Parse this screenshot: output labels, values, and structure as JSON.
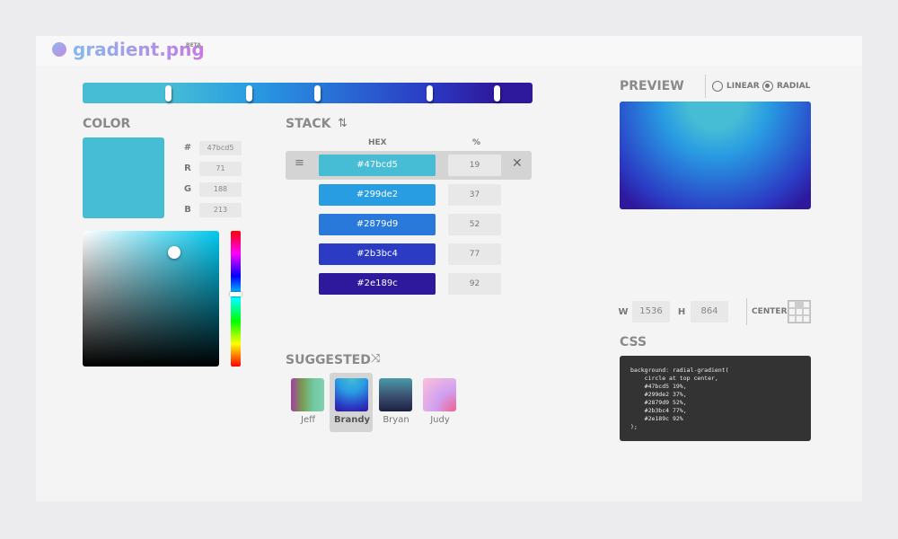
{
  "app": {
    "title": "gradient.png",
    "badge": "BETA"
  },
  "stops": [
    {
      "hex": "#47bcd5",
      "pct": 19
    },
    {
      "hex": "#299de2",
      "pct": 37
    },
    {
      "hex": "#2879d9",
      "pct": 52
    },
    {
      "hex": "#2b3bc4",
      "pct": 77
    },
    {
      "hex": "#2e189c",
      "pct": 92
    }
  ],
  "color": {
    "title": "COLOR",
    "fields": [
      {
        "label": "#",
        "value": "47bcd5"
      },
      {
        "label": "R",
        "value": "71"
      },
      {
        "label": "G",
        "value": "188"
      },
      {
        "label": "B",
        "value": "213"
      }
    ]
  },
  "stack": {
    "title": "STACK",
    "hex_header": "HEX",
    "pct_header": "%",
    "rows": [
      {
        "hex": "#47bcd5",
        "pct": "19"
      },
      {
        "hex": "#299de2",
        "pct": "37"
      },
      {
        "hex": "#2879d9",
        "pct": "52"
      },
      {
        "hex": "#2b3bc4",
        "pct": "77"
      },
      {
        "hex": "#2e189c",
        "pct": "92"
      }
    ]
  },
  "suggested": {
    "title": "SUGGESTED",
    "items": [
      {
        "name": "Jeff"
      },
      {
        "name": "Brandy",
        "selected": true
      },
      {
        "name": "Bryan"
      },
      {
        "name": "Judy"
      }
    ]
  },
  "preview": {
    "title": "PREVIEW",
    "mode_linear": "LINEAR",
    "mode_radial": "RADIAL",
    "selected_mode": "radial"
  },
  "size": {
    "w_label": "W",
    "w": "1536",
    "h_label": "H",
    "h": "864",
    "position_label": "CENTER"
  },
  "css": {
    "title": "CSS",
    "code": "background: radial-gradient(\n    circle at top center,\n    #47bcd5 19%,\n    #299de2 37%,\n    #2879d9 52%,\n    #2b3bc4 77%,\n    #2e189c 92%\n);"
  }
}
